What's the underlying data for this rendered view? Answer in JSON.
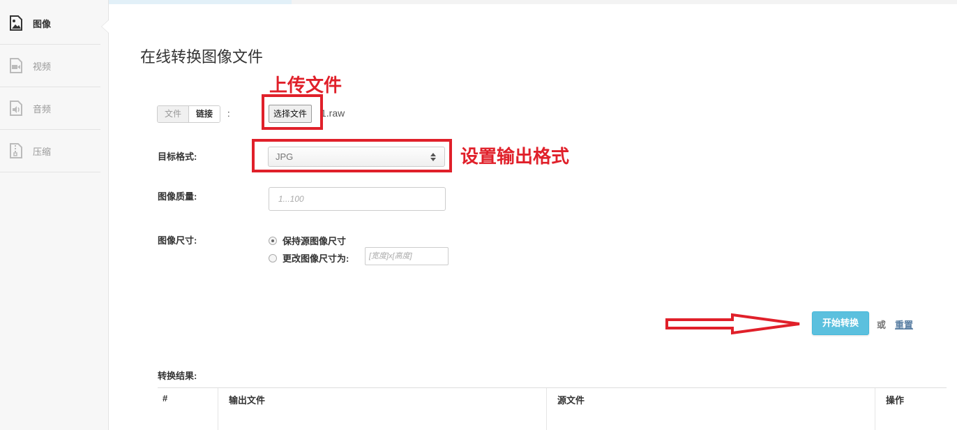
{
  "sidebar": {
    "items": [
      {
        "label": "图像",
        "icon": "image-icon",
        "active": true
      },
      {
        "label": "视频",
        "icon": "video-icon",
        "active": false
      },
      {
        "label": "音频",
        "icon": "audio-icon",
        "active": false
      },
      {
        "label": "压缩",
        "icon": "archive-icon",
        "active": false
      }
    ]
  },
  "main": {
    "title": "在线转换图像文件",
    "source": {
      "tabs": [
        "文件",
        "链接"
      ],
      "colon": ":",
      "choose_button": "选择文件",
      "file_name": "1.raw"
    },
    "target_format": {
      "label": "目标格式:",
      "value": "JPG"
    },
    "quality": {
      "label": "图像质量:",
      "placeholder": "1...100"
    },
    "size": {
      "label": "图像尺寸:",
      "options": [
        {
          "label": "保持源图像尺寸",
          "selected": true
        },
        {
          "label": "更改图像尺寸为:",
          "selected": false
        }
      ],
      "custom_placeholder": "[宽度]x[高度]"
    },
    "actions": {
      "start": "开始转换",
      "or": "或",
      "reset": "重置"
    },
    "results": {
      "label": "转换结果:",
      "columns": [
        "#",
        "输出文件",
        "源文件",
        "操作"
      ]
    }
  },
  "annotations": {
    "upload": "上传文件",
    "format": "设置输出格式"
  },
  "colors": {
    "accent": "#5bc0de",
    "annotation": "#e0202a",
    "link": "#5a7fa3"
  }
}
